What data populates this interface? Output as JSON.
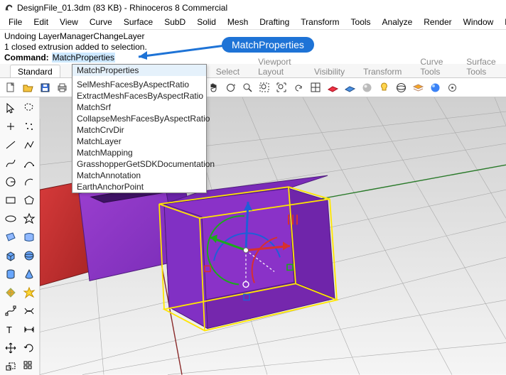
{
  "title": "DesignFile_01.3dm (83 KB) - Rhinoceros 8 Commercial",
  "menus": [
    "File",
    "Edit",
    "View",
    "Curve",
    "Surface",
    "SubD",
    "Solid",
    "Mesh",
    "Drafting",
    "Transform",
    "Tools",
    "Analyze",
    "Render",
    "Window",
    "Help"
  ],
  "history": {
    "line1": "Undoing LayerManagerChangeLayer",
    "line2": "1 closed extrusion added to selection."
  },
  "command": {
    "label": "Command:",
    "value": "MatchProperties"
  },
  "autocomplete": [
    "MatchProperties",
    "",
    "SelMeshFacesByAspectRatio",
    "ExtractMeshFacesByAspectRatio",
    "MatchSrf",
    "CollapseMeshFacesByAspectRatio",
    "MatchCrvDir",
    "MatchLayer",
    "MatchMapping",
    "GrasshopperGetSDKDocumentation",
    "MatchAnnotation",
    "EarthAnchorPoint"
  ],
  "tabs": {
    "active": "Standard",
    "right": [
      "Select",
      "Viewport Layout",
      "Visibility",
      "Transform",
      "Curve Tools",
      "Surface Tools"
    ]
  },
  "callout": "MatchProperties"
}
